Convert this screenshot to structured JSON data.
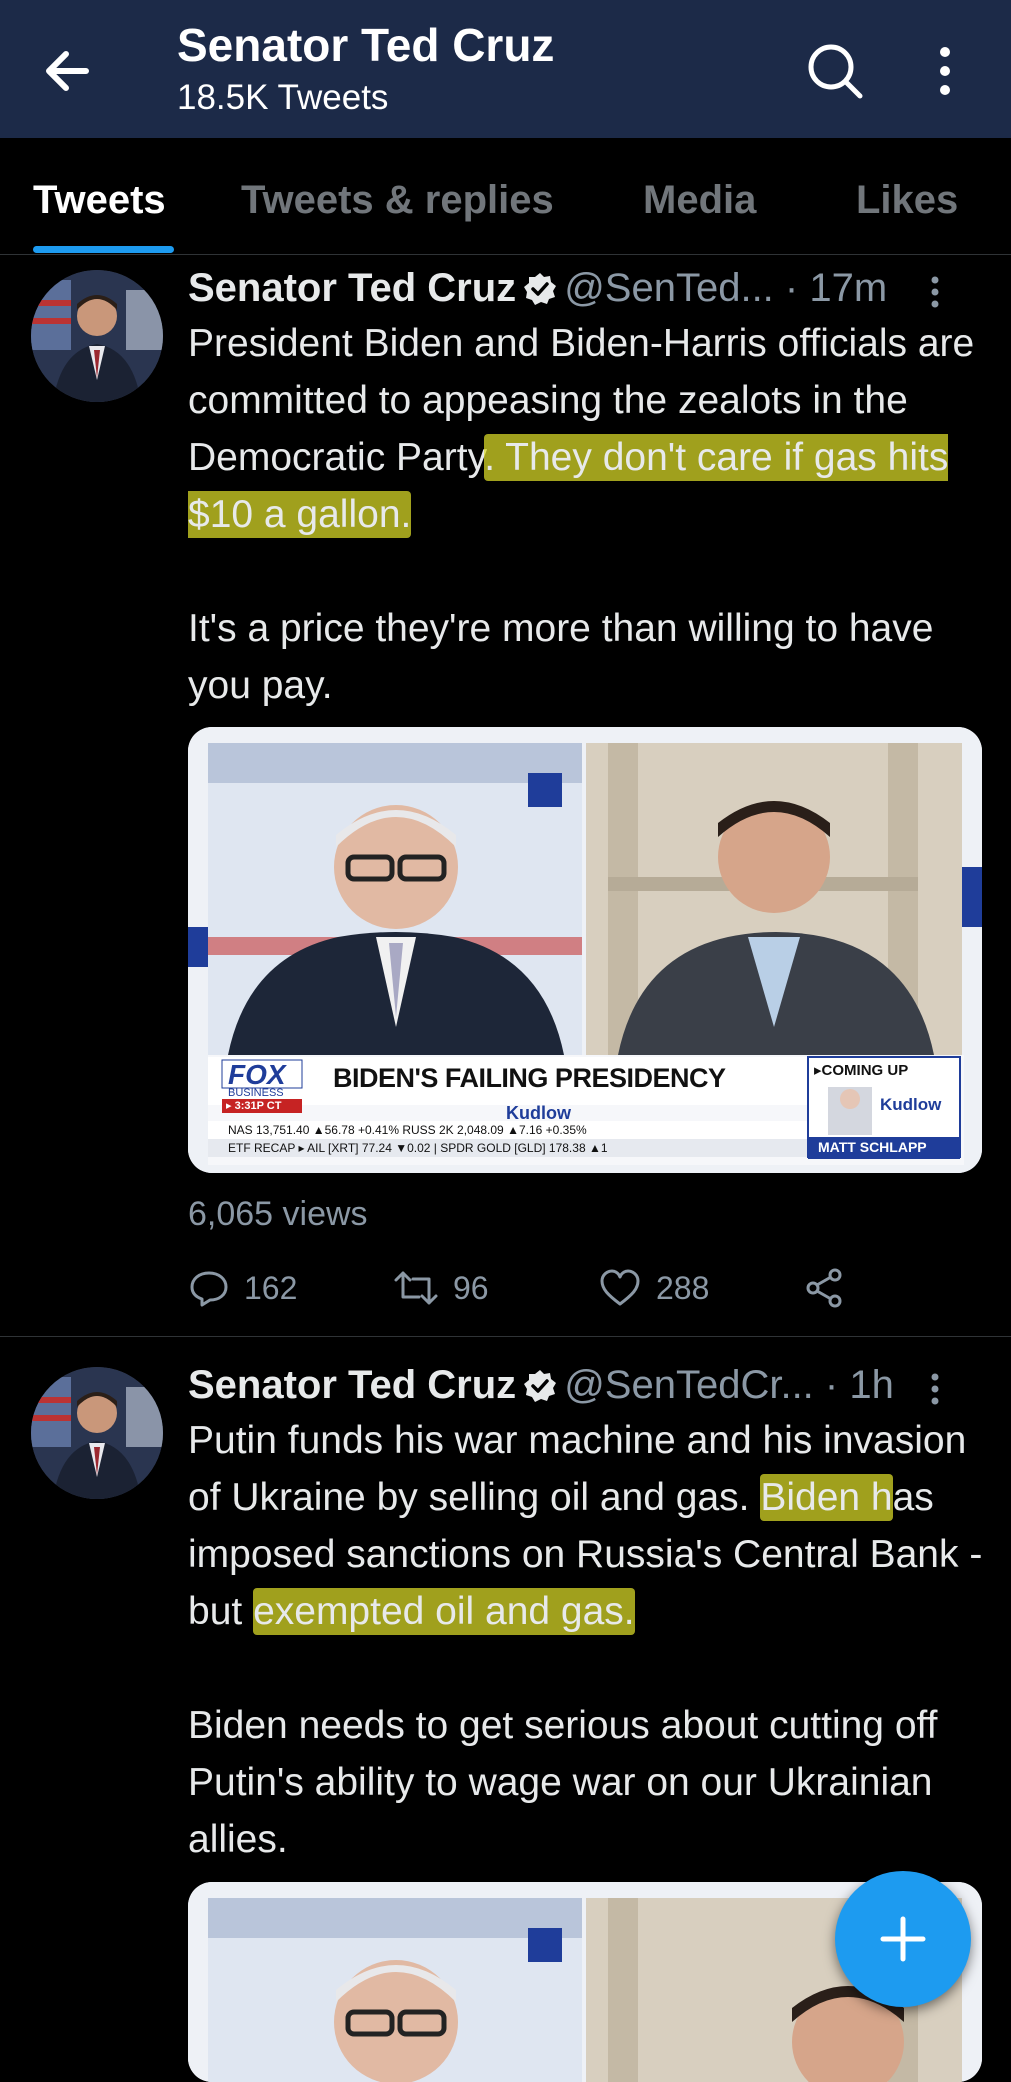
{
  "header": {
    "title": "Senator Ted Cruz",
    "subtitle": "18.5K Tweets",
    "back_icon": "arrow-left-icon",
    "search_icon": "search-icon",
    "more_icon": "more-vertical-icon"
  },
  "tabs": [
    {
      "label": "Tweets",
      "active": true
    },
    {
      "label": "Tweets & replies",
      "active": false
    },
    {
      "label": "Media",
      "active": false
    },
    {
      "label": "Likes",
      "active": false
    }
  ],
  "tweets": [
    {
      "name": "Senator Ted Cruz",
      "handle": "@SenTed...",
      "time": "· 17m",
      "text_plain_1": "President Biden and Biden-Harris officials are committed to appeasing the zealots in the Democratic Party",
      "text_highlight_1": ". They don't care if gas hits $10 a gallon.",
      "text_para_2": "It's a price they're more than willing to have you pay.",
      "media": {
        "banner_headline": "BIDEN'S FAILING PRESIDENCY",
        "show_name": "Kudlow",
        "network": "FOX",
        "network_sub": "BUSINESS",
        "clock": "▸ 3:31P CT",
        "ticker_1": "NAS   13,751.40 ▲56.78 +0.41%  RUSS 2K  2,048.09 ▲7.16 +0.35%",
        "ticker_2": "ETF RECAP ▸ AIL [XRT] 77.24 ▼0.02 | SPDR GOLD [GLD] 178.38 ▲1",
        "coming_up": "▸COMING UP",
        "coming_show": "Kudlow",
        "coming_guest": "MATT SCHLAPP"
      },
      "views": "6,065 views",
      "replies": "162",
      "retweets": "96",
      "likes": "288"
    },
    {
      "name": "Senator Ted Cruz",
      "handle": "@SenTedCr...",
      "time": "· 1h",
      "text_plain_1": "Putin funds his war machine and his invasion of Ukraine by selling oil and gas.",
      "text_highlight_1": "Biden h",
      "text_plain_2": "as imposed sanctions on Russia's Central Bank - but ",
      "text_highlight_2": "exempted oil and gas.",
      "text_para_2": "Biden needs to get serious about cutting off Putin's ability to wage war on our Ukrainian allies."
    }
  ],
  "fab": {
    "icon": "plus-icon",
    "accent": "#1d9bf0"
  }
}
